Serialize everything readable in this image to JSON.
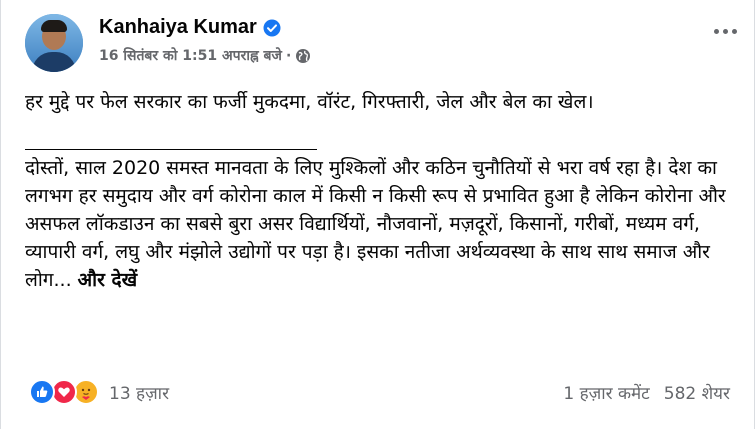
{
  "author": {
    "name": "Kanhaiya Kumar",
    "timestamp": "16 सितंबर को 1:51 अपराह्न बजे",
    "separator": "·",
    "privacy_icon": "globe-icon",
    "verified_icon": "verified-badge-icon"
  },
  "post": {
    "paragraph1": "हर मुद्दे पर फेल सरकार का फर्जी मुकदमा, वॉरंट, गिरफ्तारी, जेल और बेल का खेल।",
    "paragraph2": "दोस्तों, साल 2020 समस्त मानवता के लिए मुश्किलों और कठिन चुनौतियों से भरा वर्ष रहा है। देश का लगभग हर समुदाय और वर्ग कोरोना काल में किसी न किसी रूप से प्रभावित हुआ है लेकिन कोरोना और असफल लॉकडाउन का सबसे बुरा असर विद्यार्थियों, नौजवानों, मज़दूरों, किसानों, गरीबों, मध्यम वर्ग, व्यापारी वर्ग, लघु और मंझोले उद्योगों पर पड़ा है। इसका नतीजा अर्थव्यवस्था के साथ साथ समाज और लोग...",
    "see_more": "और देखें"
  },
  "footer": {
    "reactions": [
      "like-icon",
      "love-icon",
      "care-icon"
    ],
    "reaction_count": "13 हज़ार",
    "comments": "1 हज़ार कमेंट",
    "shares": "582 शेयर"
  },
  "colors": {
    "like": "#1877f2",
    "love": "#f0284a",
    "care": "#f7b125",
    "secondary_text": "#65676b"
  }
}
